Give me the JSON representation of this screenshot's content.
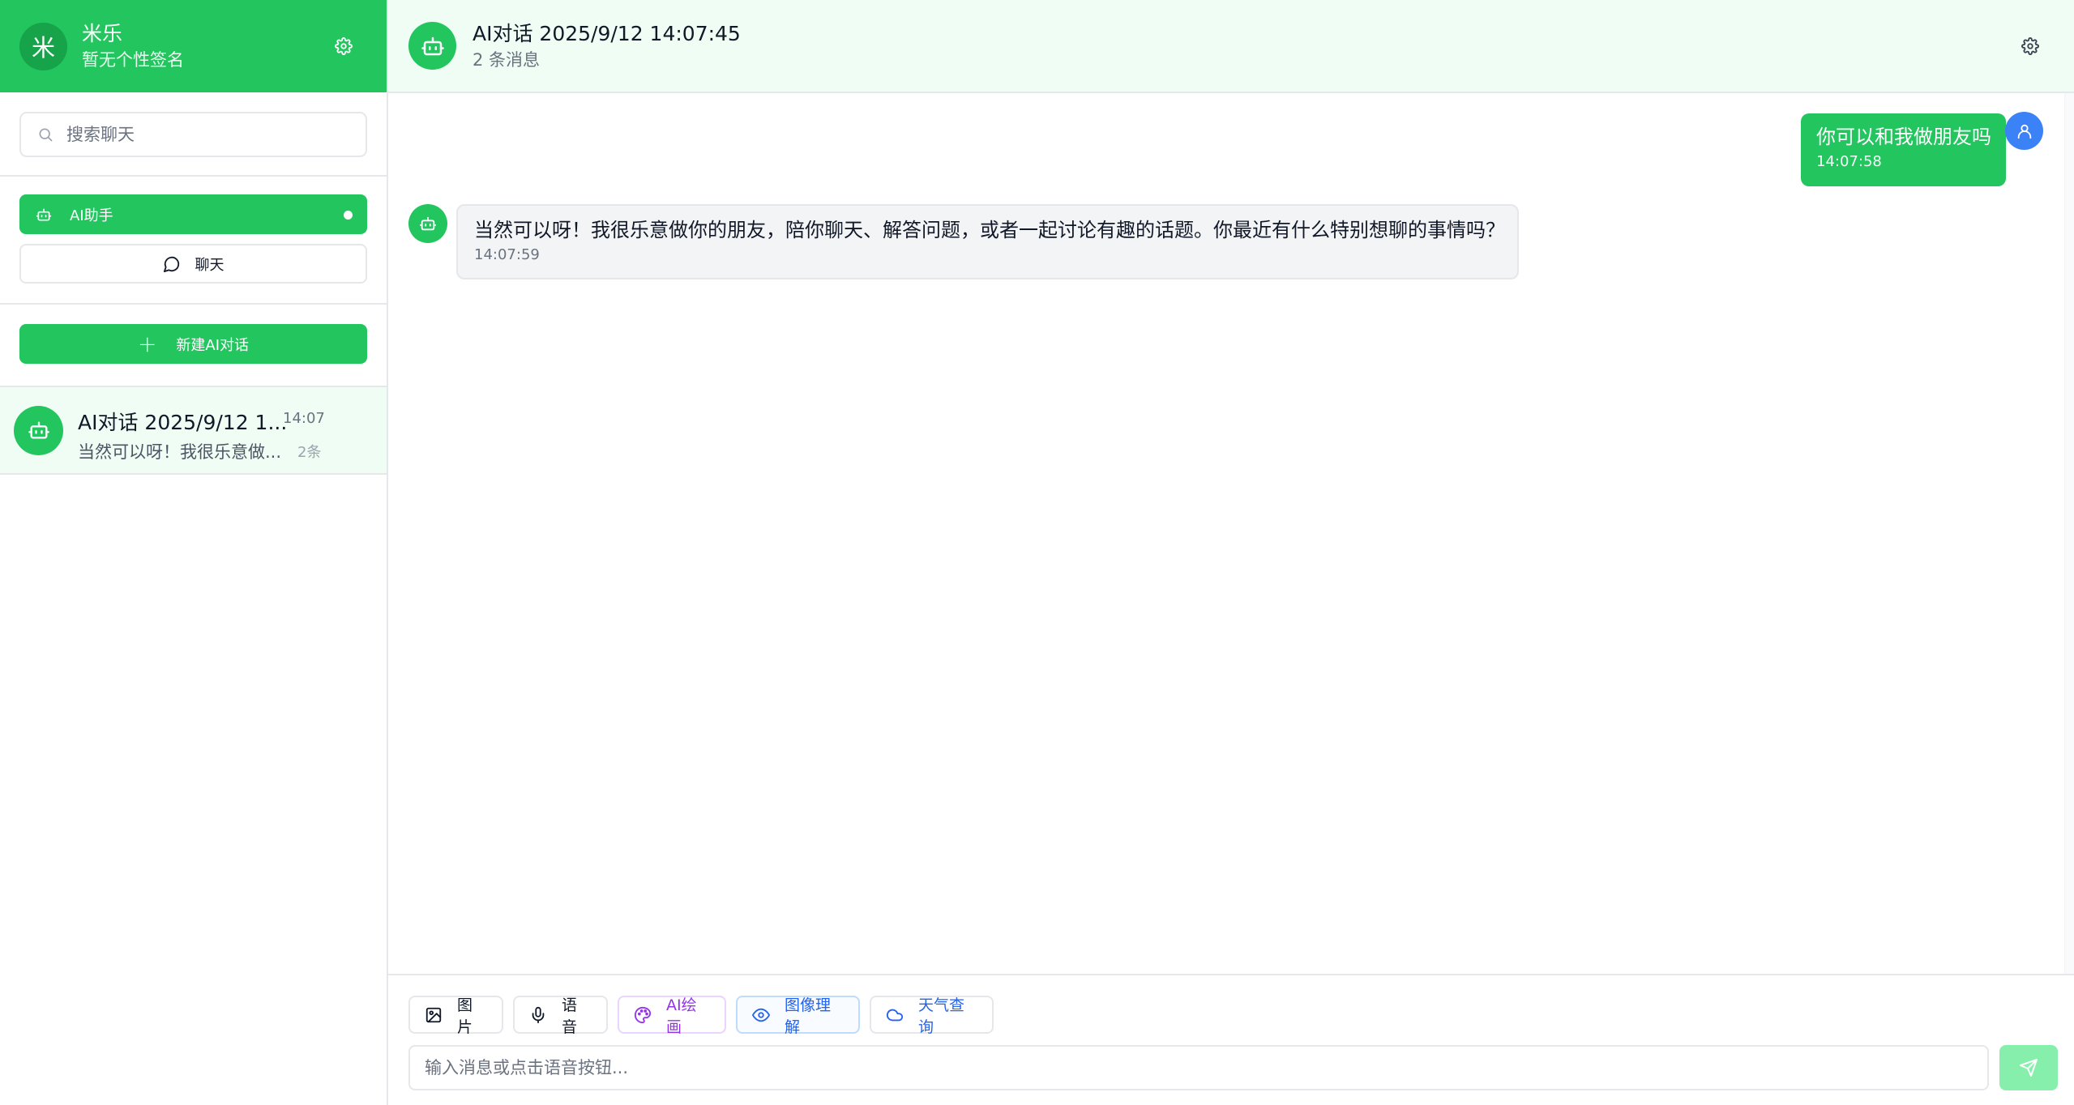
{
  "user": {
    "avatar_char": "米",
    "name": "米乐",
    "signature": "暂无个性签名"
  },
  "search": {
    "placeholder": "搜索聊天"
  },
  "modes": {
    "ai_label": "AI助手",
    "chat_label": "聊天"
  },
  "new_chat_label": "新建AI对话",
  "conversations": [
    {
      "title": "AI对话 2025/9/12 1...",
      "time": "14:07",
      "preview": "当然可以呀！我很乐意做...",
      "count": "2条"
    }
  ],
  "header": {
    "title": "AI对话 2025/9/12 14:07:45",
    "subtitle": "2 条消息"
  },
  "messages": [
    {
      "role": "user",
      "text": "你可以和我做朋友吗",
      "time": "14:07:58"
    },
    {
      "role": "assistant",
      "text": "当然可以呀！我很乐意做你的朋友，陪你聊天、解答问题，或者一起讨论有趣的话题。你最近有什么特别想聊的事情吗？",
      "time": "14:07:59"
    }
  ],
  "tools": {
    "image": "图片",
    "voice": "语音",
    "draw": "AI绘画",
    "vision": "图像理解",
    "weather": "天气查询"
  },
  "composer": {
    "placeholder": "输入消息或点击语音按钮..."
  },
  "colors": {
    "brand": "#22c55e",
    "brand_dark": "#16a34a",
    "header_bg": "#f0fdf4",
    "user_avatar": "#3b82f6",
    "draw_accent": "#9333ea",
    "vision_accent": "#2563eb",
    "send_disabled": "#86efac"
  },
  "icons": {
    "side_settings": "gear-icon",
    "search": "search-icon",
    "ai_mode": "robot-icon",
    "chat_mode": "message-circle-icon",
    "new_chat": "plus-icon",
    "tool_image": "image-icon",
    "tool_voice": "microphone-icon",
    "tool_draw": "palette-icon",
    "tool_vision": "eye-icon",
    "tool_weather": "cloud-icon",
    "send": "send-icon",
    "user_avatar": "user-icon"
  }
}
